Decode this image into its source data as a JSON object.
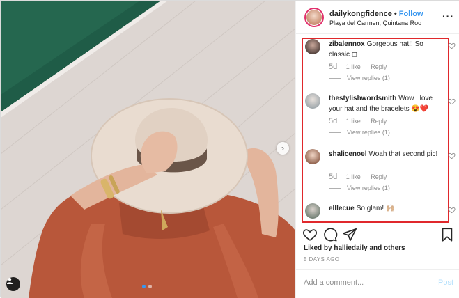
{
  "post": {
    "username": "dailykongfidence",
    "separator": "•",
    "follow_label": "Follow",
    "location": "Playa del Carmen, Quintana Roo",
    "more_label": "···"
  },
  "comments": [
    {
      "username": "zibalennox",
      "text": "Gorgeous hat!! So classic ◻",
      "age": "5d",
      "likes": "1 like",
      "reply_label": "Reply",
      "view_replies": "View replies (1)"
    },
    {
      "username": "thestylishwordsmith",
      "text": "Wow I love your hat and the bracelets 😍❤️",
      "age": "5d",
      "likes": "1 like",
      "reply_label": "Reply",
      "view_replies": "View replies (1)"
    },
    {
      "username": "shalicenoel",
      "text": "Woah that second pic!",
      "age": "5d",
      "likes": "1 like",
      "reply_label": "Reply",
      "view_replies": "View replies (1)"
    },
    {
      "username": "elllecue",
      "text": "So glam! 🙌🏼"
    }
  ],
  "engagement": {
    "liked_by": "Liked by halliedaily and others",
    "time_ago": "5 DAYS AGO"
  },
  "composer": {
    "placeholder": "Add a comment...",
    "post_label": "Post"
  },
  "media": {
    "next_glyph": "›",
    "carousel_count": 2,
    "carousel_active": 0
  },
  "colors": {
    "follow_blue": "#3897f0",
    "highlight_red": "#e0282c",
    "muted_gray": "#8e8e8e",
    "post_disabled": "#b2dffc"
  }
}
